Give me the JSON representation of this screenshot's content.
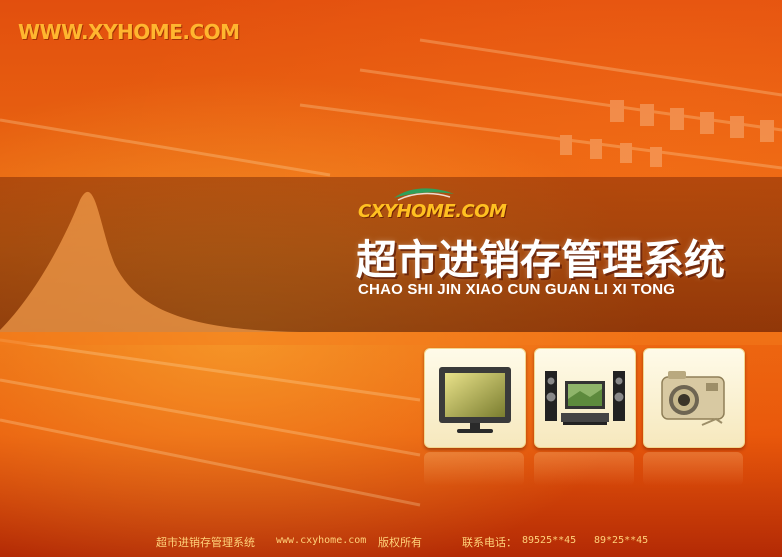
{
  "header": {
    "site_logo": "WWW.XYHOME.COM"
  },
  "hero": {
    "brand": "CXYHOME.COM",
    "title": "超市进销存管理系统",
    "subtitle": "CHAO SHI JIN XIAO CUN GUAN LI XI TONG"
  },
  "tiles": [
    {
      "icon": "tv-monitor-icon"
    },
    {
      "icon": "home-theater-icon"
    },
    {
      "icon": "camera-icon"
    }
  ],
  "footer": {
    "name": "超市进销存管理系统",
    "url": "www.cxyhome.com",
    "copyright": "版权所有",
    "phone_label": "联系电话：",
    "phone1": "89525**45",
    "phone2": "89*25**45"
  },
  "colors": {
    "accent": "#ffb62f",
    "background": "#e8600f",
    "footer_text": "#ffd27a"
  }
}
